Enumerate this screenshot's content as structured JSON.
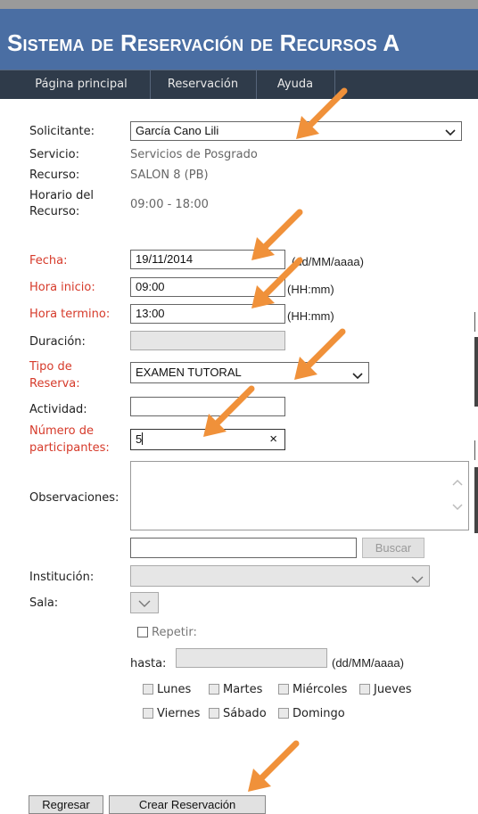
{
  "header": {
    "title": "Sistema de Reservación de Recursos A"
  },
  "nav": {
    "items": [
      "Página principal",
      "Reservación",
      "Ayuda"
    ]
  },
  "form": {
    "solicitante": {
      "label": "Solicitante:",
      "value": "García Cano Lili"
    },
    "servicio": {
      "label": "Servicio:",
      "value": "Servicios de Posgrado"
    },
    "recurso": {
      "label": "Recurso:",
      "value": "SALON 8 (PB)"
    },
    "horario": {
      "label_line1": "Horario del",
      "label_line2": "Recurso:",
      "value": "09:00 - 18:00"
    },
    "fecha": {
      "label": "Fecha:",
      "value": "19/11/2014",
      "hint": "(dd/MM/aaaa)"
    },
    "hora_inicio": {
      "label": "Hora inicio:",
      "value": "09:00",
      "hint": "(HH:mm)"
    },
    "hora_termino": {
      "label": "Hora termino:",
      "value": "13:00",
      "hint": "(HH:mm)"
    },
    "duracion": {
      "label": "Duración:",
      "value": ""
    },
    "tipo_reserva": {
      "label_line1": "Tipo de",
      "label_line2": "Reserva:",
      "value": "EXAMEN TUTORAL"
    },
    "actividad": {
      "label": "Actividad:",
      "value": ""
    },
    "participantes": {
      "label_line1": "Número de",
      "label_line2": "participantes:",
      "value": "5",
      "clear": "×"
    },
    "observaciones": {
      "label": "Observaciones:",
      "value": ""
    },
    "buscar": {
      "value": "",
      "button": "Buscar"
    },
    "institucion": {
      "label": "Institución:",
      "value": ""
    },
    "sala": {
      "label": "Sala:",
      "value": ""
    },
    "repetir": {
      "label": "Repetir:"
    },
    "hasta": {
      "label": "hasta:",
      "value": "",
      "hint": "(dd/MM/aaaa)"
    },
    "days": [
      "Lunes",
      "Martes",
      "Miércoles",
      "Jueves",
      "Viernes",
      "Sábado",
      "Domingo"
    ]
  },
  "actions": {
    "back": "Regresar",
    "create": "Crear Reservación"
  },
  "colors": {
    "header_bg": "#4a6ea3",
    "nav_bg": "#2f3b4a",
    "required_label": "#d63a2a",
    "arrow": "#f0913a"
  },
  "icons": [
    "chevron-down-icon",
    "clear-icon",
    "scroll-up-icon",
    "scroll-down-icon",
    "checkbox-icon",
    "annotation-arrow-icon"
  ]
}
